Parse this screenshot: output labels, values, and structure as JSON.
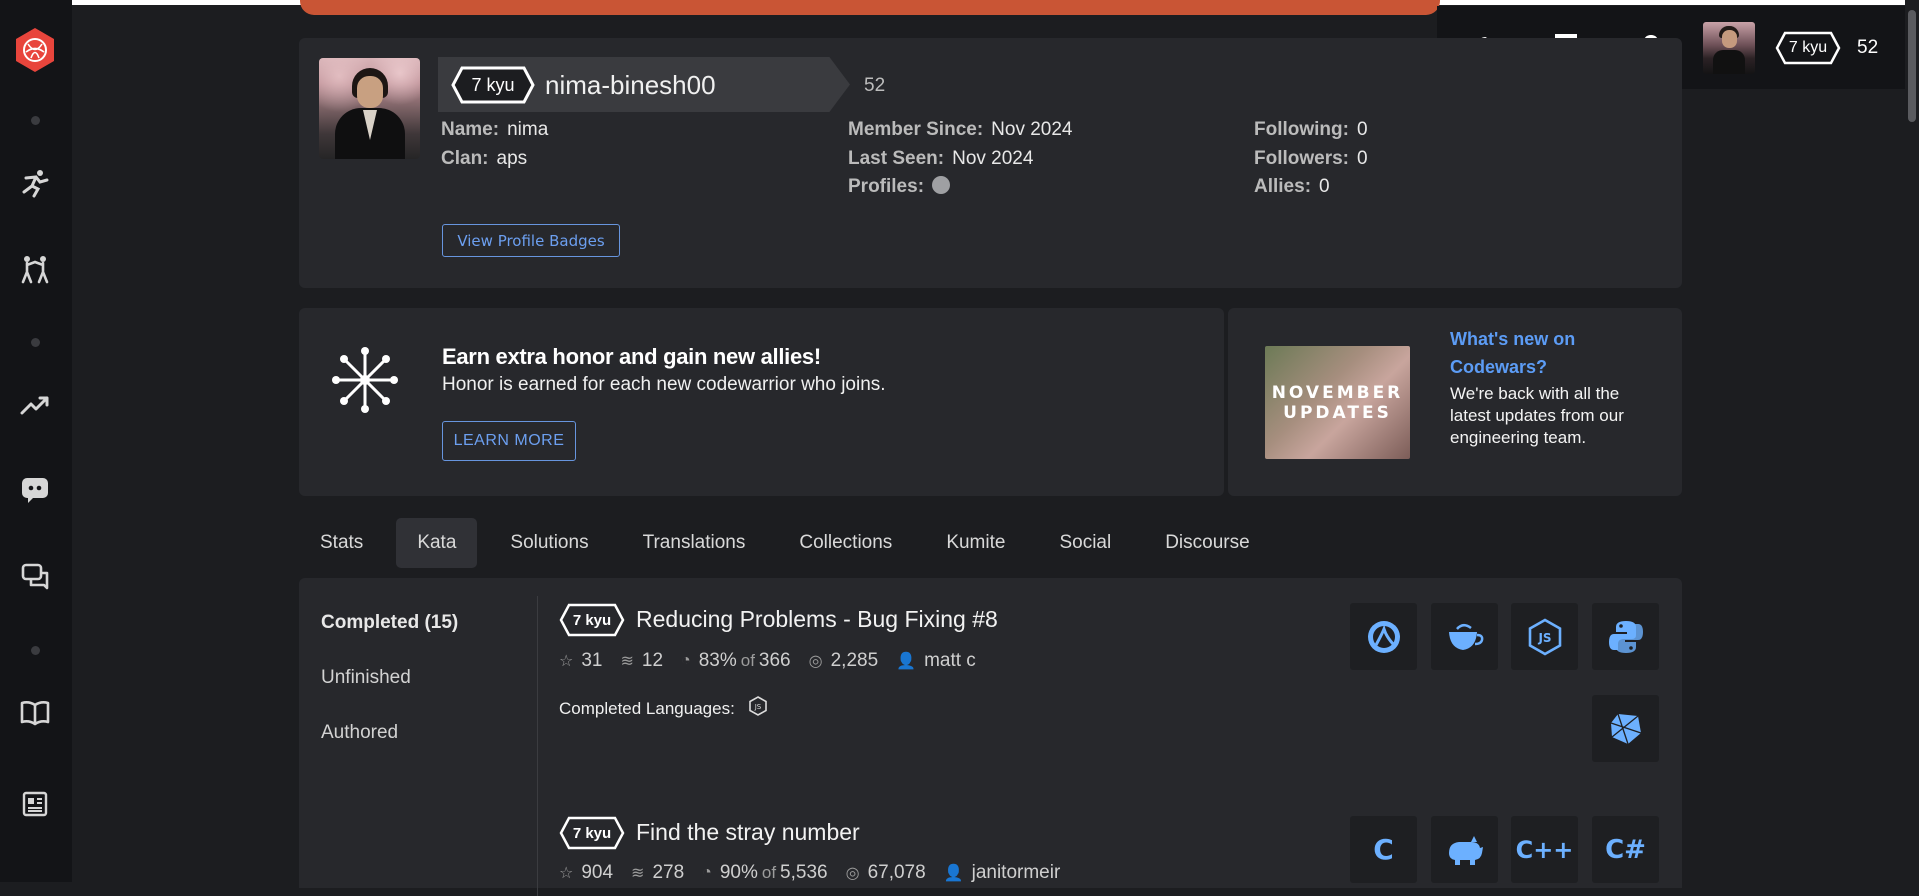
{
  "header": {
    "rank": "7 kyu",
    "honor": "52"
  },
  "profile": {
    "rank": "7 kyu",
    "username": "nima-binesh00",
    "honor": "52",
    "name_label": "Name:",
    "name_value": "nima",
    "clan_label": "Clan:",
    "clan_value": "aps",
    "member_since_label": "Member Since:",
    "member_since_value": "Nov 2024",
    "last_seen_label": "Last Seen:",
    "last_seen_value": "Nov 2024",
    "profiles_label": "Profiles:",
    "following_label": "Following:",
    "following_value": "0",
    "followers_label": "Followers:",
    "followers_value": "0",
    "allies_label": "Allies:",
    "allies_value": "0",
    "badges_button": "View Profile Badges"
  },
  "promo": {
    "title": "Earn extra honor and gain new allies!",
    "subtitle": "Honor is earned for each new codewarrior who joins.",
    "button": "LEARN MORE"
  },
  "whats_new": {
    "image_line1": "NOVEMBER",
    "image_line2": "UPDATES",
    "title": "What's new on Codewars?",
    "text": "We're back with all the latest updates from our engineering team."
  },
  "tabs": [
    "Stats",
    "Kata",
    "Solutions",
    "Translations",
    "Collections",
    "Kumite",
    "Social",
    "Discourse"
  ],
  "kata_nav": [
    "Completed (15)",
    "Unfinished",
    "Authored"
  ],
  "katas": [
    {
      "rank": "7 kyu",
      "title": "Reducing Problems - Bug Fixing #8",
      "stars": "31",
      "collections": "12",
      "satisfaction": "83%",
      "of_label": "of",
      "votes": "366",
      "completions": "2,285",
      "author": "matt c",
      "completed_languages_label": "Completed Languages:",
      "languages": [
        "clojure-icon",
        "coffeescript-icon",
        "javascript-icon",
        "python-icon",
        "ruby-icon"
      ]
    },
    {
      "rank": "7 kyu",
      "title": "Find the stray number",
      "stars": "904",
      "collections": "278",
      "satisfaction": "90%",
      "of_label": "of",
      "votes": "5,536",
      "completions": "67,078",
      "author": "janitormeir",
      "languages": [
        "c-icon",
        "cfml-icon",
        "cpp-icon",
        "csharp-icon"
      ]
    }
  ],
  "lang_text": {
    "c": "C",
    "cpp": "C++",
    "csharp": "C#"
  },
  "colors": {
    "accent": "#c95535",
    "link": "#6c9ff0",
    "lang_icon": "#6cb0ff",
    "bg": "#1c1d20",
    "card": "#27282c"
  }
}
